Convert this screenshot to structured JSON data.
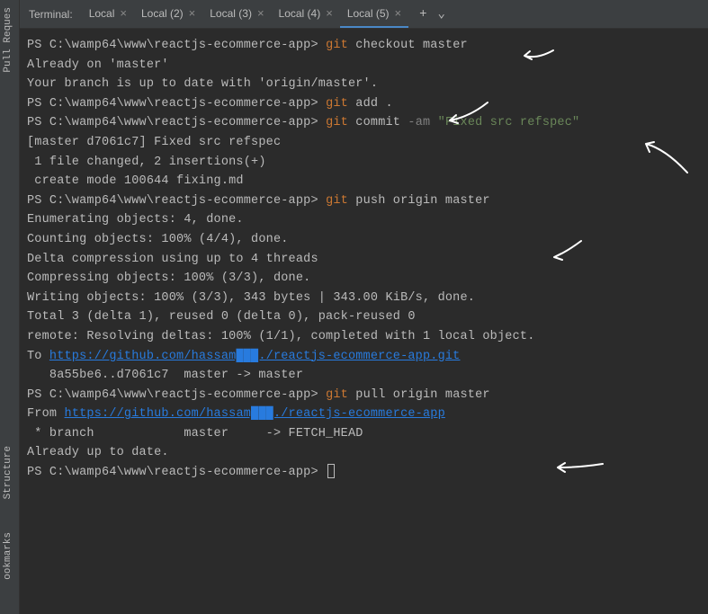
{
  "header": {
    "label": "Terminal:"
  },
  "tabs": [
    {
      "label": "Local",
      "active": false
    },
    {
      "label": "Local (2)",
      "active": false
    },
    {
      "label": "Local (3)",
      "active": false
    },
    {
      "label": "Local (4)",
      "active": false
    },
    {
      "label": "Local (5)",
      "active": true
    }
  ],
  "side": {
    "pull": "Pull Reques",
    "structure": "Structure",
    "bookmarks": "ookmarks"
  },
  "term": {
    "prompt": "PS C:\\wamp64\\www\\reactjs-ecommerce-app>",
    "git": "git",
    "cmd_checkout": " checkout master",
    "already_master": "Already on 'master'",
    "upto_date": "Your branch is up to date with 'origin/master'.",
    "cmd_add": " add .",
    "cmd_commit": " commit ",
    "flag_am": "-am",
    "commit_msg": " \"Fixed src refspec\"",
    "commit_out1": "[master d7061c7] Fixed src refspec",
    "commit_out2": " 1 file changed, 2 insertions(+)",
    "commit_out3": " create mode 100644 fixing.md",
    "cmd_push": " push origin master",
    "push1": "Enumerating objects: 4, done.",
    "push2": "Counting objects: 100% (4/4), done.",
    "push3": "Delta compression using up to 4 threads",
    "push4": "Compressing objects: 100% (3/3), done.",
    "push5": "Writing objects: 100% (3/3), 343 bytes | 343.00 KiB/s, done.",
    "push6": "Total 3 (delta 1), reused 0 (delta 0), pack-reused 0",
    "push7": "remote: Resolving deltas: 100% (1/1), completed with 1 local object.",
    "push_to": "To ",
    "push_url": "https://github.com/hassam███./reactjs-ecommerce-app.git",
    "push_ref": "   8a55be6..d7061c7  master -> master",
    "cmd_pull": " pull origin master",
    "pull_from": "From ",
    "pull_url": "https://github.com/hassam███./reactjs-ecommerce-app",
    "pull_branch": " * branch            master     -> FETCH_HEAD",
    "pull_done": "Already up to date."
  }
}
